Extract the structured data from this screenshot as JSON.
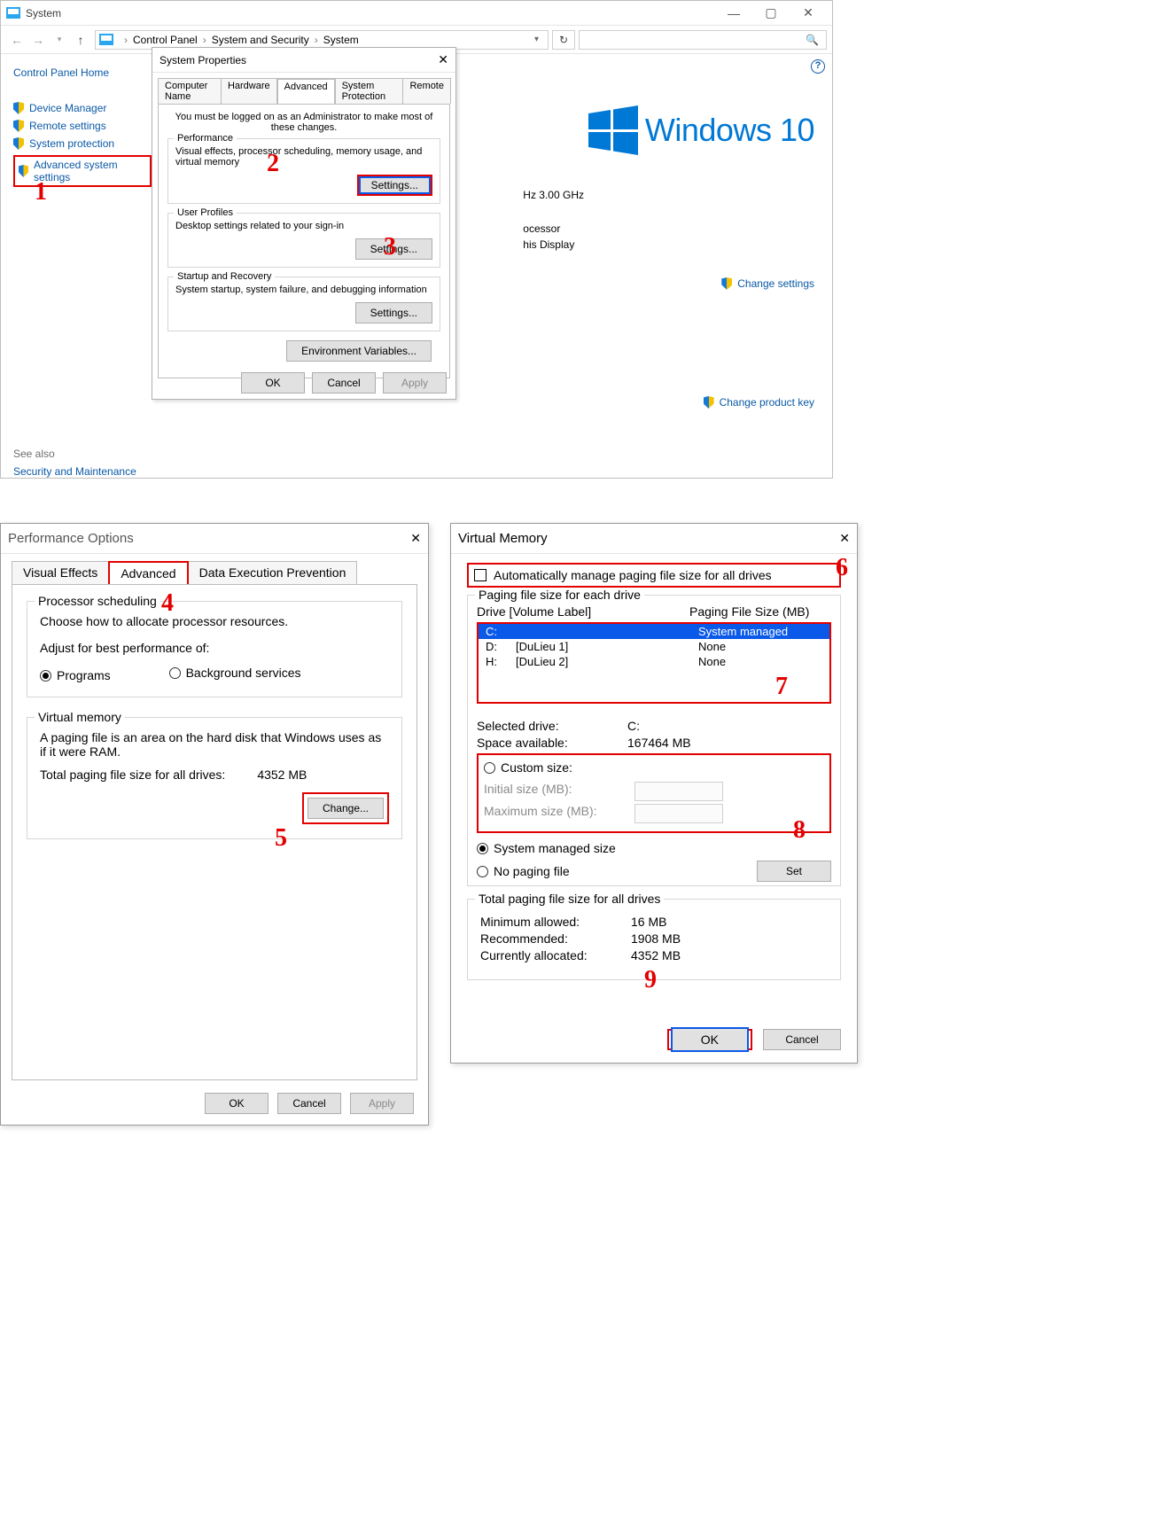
{
  "cp": {
    "title": "System",
    "crumbs": [
      "Control Panel",
      "System and Security",
      "System"
    ],
    "side_home": "Control Panel Home",
    "side_items": [
      "Device Manager",
      "Remote settings",
      "System protection",
      "Advanced system settings"
    ],
    "see_also": "See also",
    "see_link": "Security and Maintenance",
    "win_brand": "Windows 10",
    "frag1": "Hz   3.00 GHz",
    "frag2": "ocessor",
    "frag3": "his Display",
    "change_settings": "Change settings",
    "change_key": "Change product key"
  },
  "sysprops": {
    "title": "System Properties",
    "tabs": [
      "Computer Name",
      "Hardware",
      "Advanced",
      "System Protection",
      "Remote"
    ],
    "note": "You must be logged on as an Administrator to make most of these changes.",
    "perf_title": "Performance",
    "perf_desc": "Visual effects, processor scheduling, memory usage, and virtual memory",
    "users_title": "User Profiles",
    "users_desc": "Desktop settings related to your sign-in",
    "startup_title": "Startup and Recovery",
    "startup_desc": "System startup, system failure, and debugging information",
    "settings_btn": "Settings...",
    "env_btn": "Environment Variables...",
    "ok": "OK",
    "cancel": "Cancel",
    "apply": "Apply"
  },
  "perf": {
    "title": "Performance Options",
    "tabs": [
      "Visual Effects",
      "Advanced",
      "Data Execution Prevention"
    ],
    "sched_title": "Processor scheduling",
    "sched_line": "Choose how to allocate processor resources.",
    "adjust_line": "Adjust for best performance of:",
    "radio_programs": "Programs",
    "radio_background": "Background services",
    "vm_title": "Virtual memory",
    "vm_desc": "A paging file is an area on the hard disk that Windows uses as if it were RAM.",
    "vm_total_label": "Total paging file size for all drives:",
    "vm_total_value": "4352 MB",
    "change": "Change...",
    "ok": "OK",
    "cancel": "Cancel",
    "apply": "Apply"
  },
  "vm": {
    "title": "Virtual Memory",
    "auto_label": "Automatically manage paging file size for all drives",
    "group_title": "Paging file size for each drive",
    "col1": "Drive  [Volume Label]",
    "col2": "Paging File Size (MB)",
    "drives": [
      {
        "letter": "C:",
        "label": "",
        "size": "System managed",
        "sel": true
      },
      {
        "letter": "D:",
        "label": "[DuLieu 1]",
        "size": "None",
        "sel": false
      },
      {
        "letter": "H:",
        "label": "[DuLieu 2]",
        "size": "None",
        "sel": false
      }
    ],
    "selected_label": "Selected drive:",
    "selected_val": "C:",
    "space_label": "Space available:",
    "space_val": "167464 MB",
    "custom": "Custom size:",
    "init_label": "Initial size (MB):",
    "max_label": "Maximum size (MB):",
    "sys_managed": "System managed size",
    "no_paging": "No paging file",
    "set": "Set",
    "totals_title": "Total paging file size for all drives",
    "min_label": "Minimum allowed:",
    "min_val": "16 MB",
    "rec_label": "Recommended:",
    "rec_val": "1908 MB",
    "cur_label": "Currently allocated:",
    "cur_val": "4352 MB",
    "ok": "OK",
    "cancel": "Cancel"
  },
  "nums": {
    "n1": "1",
    "n2": "2",
    "n3": "3",
    "n4": "4",
    "n5": "5",
    "n6": "6",
    "n7": "7",
    "n8": "8",
    "n9": "9"
  }
}
